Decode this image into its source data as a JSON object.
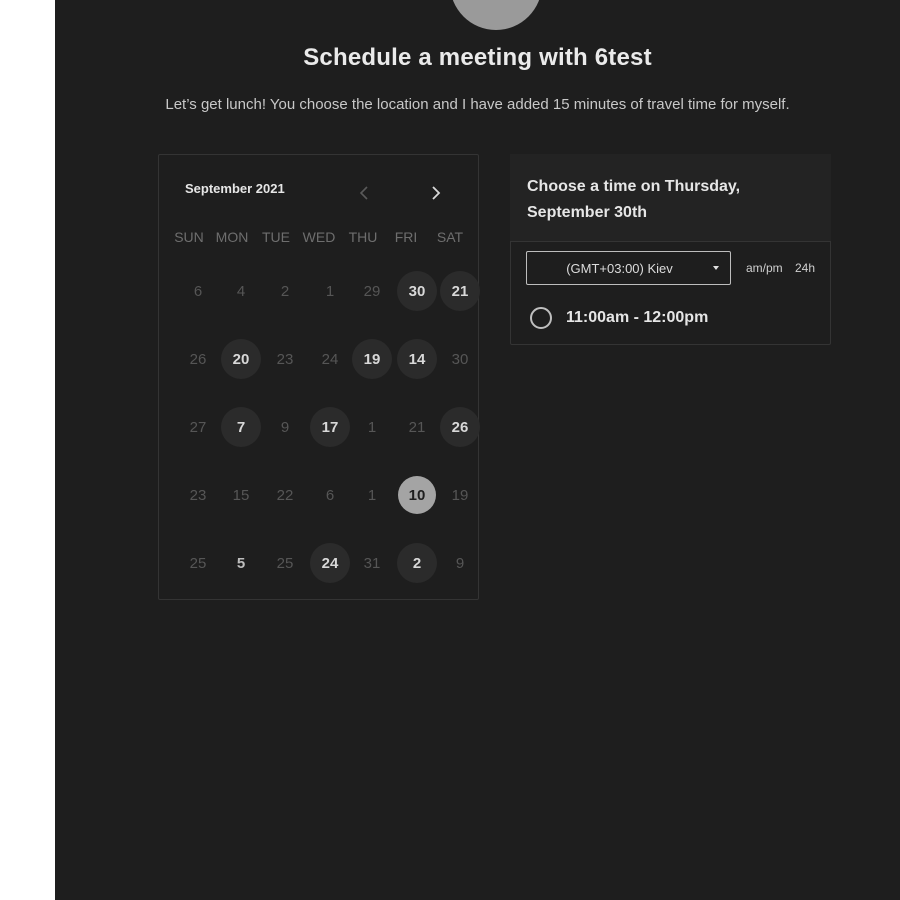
{
  "header": {
    "title": "Schedule a meeting with 6test",
    "description": "Let’s get lunch! You choose the location and I have added 15 minutes of travel time for myself."
  },
  "calendar": {
    "month_label": "September 2021",
    "weekdays": [
      "SUN",
      "MON",
      "TUE",
      "WED",
      "THU",
      "FRI",
      "SAT"
    ],
    "weeks": [
      [
        {
          "d": "6",
          "s": "off"
        },
        {
          "d": "4",
          "s": "off"
        },
        {
          "d": "2",
          "s": "off"
        },
        {
          "d": "1",
          "s": "off"
        },
        {
          "d": "29",
          "s": "off"
        },
        {
          "d": "30",
          "s": "avail"
        },
        {
          "d": "21",
          "s": "avail"
        }
      ],
      [
        {
          "d": "26",
          "s": "off"
        },
        {
          "d": "20",
          "s": "avail"
        },
        {
          "d": "23",
          "s": "off"
        },
        {
          "d": "24",
          "s": "off"
        },
        {
          "d": "19",
          "s": "avail"
        },
        {
          "d": "14",
          "s": "avail"
        },
        {
          "d": "30",
          "s": "off"
        }
      ],
      [
        {
          "d": "27",
          "s": "off"
        },
        {
          "d": "7",
          "s": "avail"
        },
        {
          "d": "9",
          "s": "off"
        },
        {
          "d": "17",
          "s": "avail"
        },
        {
          "d": "1",
          "s": "off"
        },
        {
          "d": "21",
          "s": "off"
        },
        {
          "d": "26",
          "s": "avail"
        }
      ],
      [
        {
          "d": "23",
          "s": "off"
        },
        {
          "d": "15",
          "s": "off"
        },
        {
          "d": "22",
          "s": "off"
        },
        {
          "d": "6",
          "s": "off"
        },
        {
          "d": "1",
          "s": "off"
        },
        {
          "d": "10",
          "s": "selected"
        },
        {
          "d": "19",
          "s": "off"
        }
      ],
      [
        {
          "d": "25",
          "s": "off"
        },
        {
          "d": "5",
          "s": "off_bold"
        },
        {
          "d": "25",
          "s": "off"
        },
        {
          "d": "24",
          "s": "avail"
        },
        {
          "d": "31",
          "s": "off"
        },
        {
          "d": "2",
          "s": "avail"
        },
        {
          "d": "9",
          "s": "off"
        }
      ]
    ]
  },
  "timepicker": {
    "heading": "Choose a time on Thursday, September 30th",
    "timezone": "(GMT+03:00) Kiev",
    "format_12": "am/pm",
    "format_24": "24h",
    "slots": [
      {
        "label": "11:00am - 12:00pm"
      }
    ]
  },
  "colors": {
    "background": "#1e1e1e",
    "page": "#ffffff",
    "selected_day": "#a4a4a4"
  }
}
